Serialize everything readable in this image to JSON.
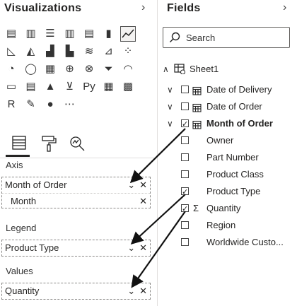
{
  "visualizations": {
    "title": "Visualizations",
    "chevron": "›"
  },
  "fields": {
    "title": "Fields",
    "chevron": "›",
    "search_placeholder": "Search",
    "table_name": "Sheet1",
    "items": [
      {
        "label": "Date of Delivery",
        "type": "date",
        "expandable": true,
        "checked": false,
        "bold": false
      },
      {
        "label": "Date of Order",
        "type": "date",
        "expandable": true,
        "checked": false,
        "bold": false
      },
      {
        "label": "Month of Order",
        "type": "date",
        "expandable": true,
        "checked": true,
        "bold": true
      },
      {
        "label": "Owner",
        "type": "text",
        "expandable": false,
        "checked": false,
        "bold": false
      },
      {
        "label": "Part Number",
        "type": "text",
        "expandable": false,
        "checked": false,
        "bold": false
      },
      {
        "label": "Product Class",
        "type": "text",
        "expandable": false,
        "checked": false,
        "bold": false
      },
      {
        "label": "Product Type",
        "type": "text",
        "expandable": false,
        "checked": true,
        "bold": false
      },
      {
        "label": "Quantity",
        "type": "sum",
        "expandable": false,
        "checked": true,
        "bold": false
      },
      {
        "label": "Region",
        "type": "text",
        "expandable": false,
        "checked": false,
        "bold": false
      },
      {
        "label": "Worldwide Custo...",
        "type": "text",
        "expandable": false,
        "checked": false,
        "bold": false
      }
    ]
  },
  "wells": {
    "axis": {
      "label": "Axis",
      "field": "Month of Order",
      "sub": "Month"
    },
    "legend": {
      "label": "Legend",
      "field": "Product Type"
    },
    "values": {
      "label": "Values",
      "field": "Quantity"
    }
  },
  "viz_icons": [
    "stacked-bar-icon",
    "stacked-column-icon",
    "clustered-bar-icon",
    "clustered-column-icon",
    "100-stacked-bar-icon",
    "100-stacked-column-icon",
    "line-chart-icon",
    "area-chart-icon",
    "stacked-area-icon",
    "line-clustered-column-icon",
    "line-stacked-column-icon",
    "ribbon-chart-icon",
    "waterfall-icon",
    "scatter-icon",
    "pie-chart-icon",
    "donut-chart-icon",
    "treemap-icon",
    "map-icon",
    "filled-map-icon",
    "funnel-icon",
    "gauge-icon",
    "card-icon",
    "multi-row-card-icon",
    "kpi-icon",
    "slicer-icon",
    "python-visual-icon",
    "table-icon",
    "matrix-icon",
    "r-visual-icon",
    "arcgis-icon",
    "globe-icon",
    "more-visuals-icon"
  ],
  "colors": {
    "accent": "#252423",
    "border": "#8a8886"
  }
}
